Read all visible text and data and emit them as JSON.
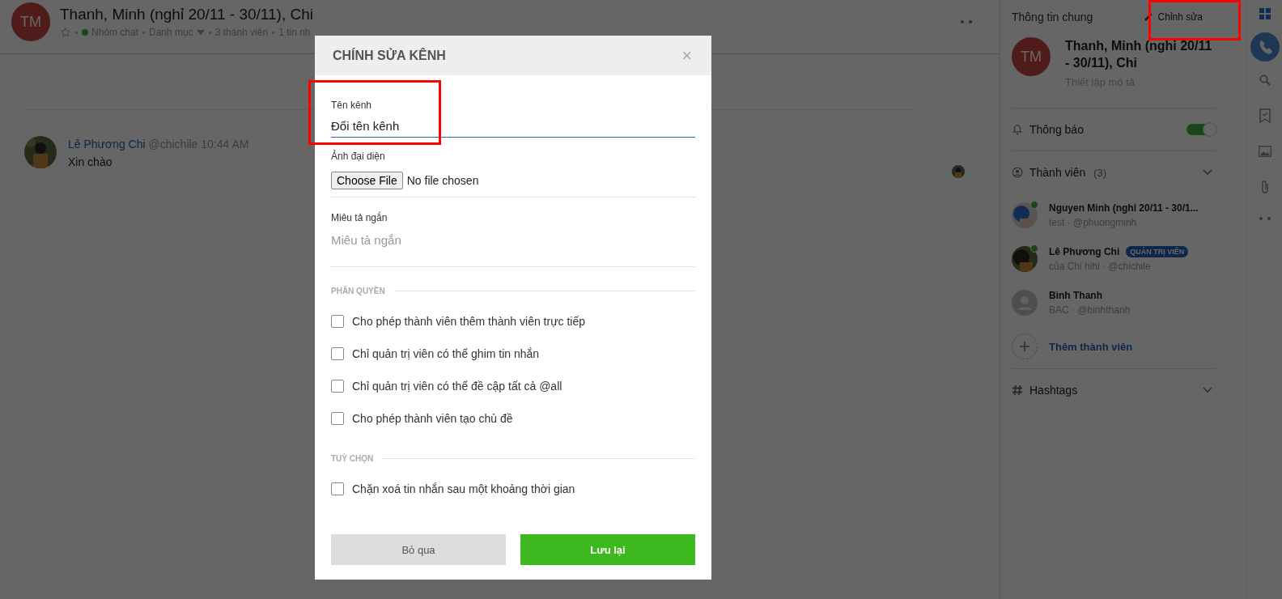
{
  "header": {
    "avatar": "TM",
    "title": "Thanh, Minh (nghỉ 20/11 - 30/11), Chi",
    "type": "Nhóm chat",
    "category": "Danh mục",
    "members": "3 thành viên",
    "messages": "1 tin nh"
  },
  "messages": [
    {
      "author": "Lê Phương Chi",
      "handle": "@chichile",
      "time": "10:44 AM",
      "text": "Xin chào"
    }
  ],
  "info_panel": {
    "title": "Thông tin chung",
    "edit": "Chỉnh sửa",
    "avatar": "TM",
    "name": "Thanh, Minh (nghỉ 20/11 - 30/11), Chi",
    "description_placeholder": "Thiết lập mô tả",
    "notification": {
      "label": "Thông báo",
      "on": true
    },
    "members_label": "Thành viên",
    "members_count": "(3)",
    "members": [
      {
        "name": "Nguyen Minh (nghỉ 20/11 - 30/1...",
        "subtitle": "test · @phuongminh",
        "online": true
      },
      {
        "name": "Lê Phương Chi",
        "badge": "QUẢN TRỊ VIÊN",
        "subtitle": "của Chi hihi · @chichile",
        "online": true
      },
      {
        "name": "Bình Thanh",
        "subtitle": "BAC · @binhthanh",
        "online": false,
        "kind": "placeholder"
      }
    ],
    "add_member": "Thêm thành viên",
    "hashtags": "Hashtags"
  },
  "modal": {
    "title": "CHÍNH SỬA KÊNH",
    "close": "×",
    "name_label": "Tên kênh",
    "name_value": "Đổi tên kênh",
    "avatar_label": "Ảnh đại diện",
    "file_button": "Choose File",
    "file_status": "No file chosen",
    "description_label": "Miêu tả ngắn",
    "description_placeholder": "Miêu tả ngắn",
    "sections": [
      {
        "title": "PHÂN QUYỀN",
        "options": [
          {
            "label": "Cho phép thành viên thêm thành viên trực tiếp",
            "checked": false
          },
          {
            "label": "Chỉ quản trị viên có thể ghim tin nhắn",
            "checked": false
          },
          {
            "label": "Chỉ quản trị viên có thể đề cập tất cả @all",
            "checked": false
          },
          {
            "label": "Cho phép thành viên tạo chủ đề",
            "checked": false
          }
        ]
      },
      {
        "title": "TUỲ CHỌN",
        "options": [
          {
            "label": "Chặn xoá tin nhắn sau một khoảng thời gian",
            "checked": false
          }
        ]
      }
    ],
    "cancel": "Bỏ qua",
    "save": "Lưu lại"
  }
}
